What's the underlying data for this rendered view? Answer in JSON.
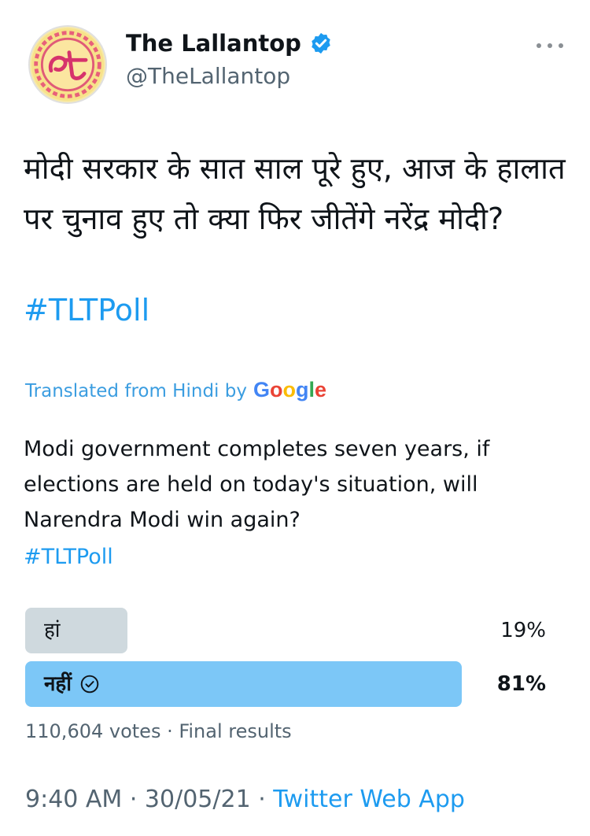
{
  "header": {
    "display_name": "The Lallantop",
    "handle": "@TheLallantop",
    "avatar_icon": "lallantop-logo",
    "verified_icon": "verified-badge-icon",
    "more_icon": "more-options-icon"
  },
  "tweet": {
    "hindi_text": "मोदी सरकार के सात साल पूरे हुए, आज के हालात पर चुनाव हुए तो क्या फिर जीतेंगे नरेंद्र मोदी?",
    "hashtag": "#TLTPoll"
  },
  "translation": {
    "label": "Translated from Hindi by",
    "google": [
      "G",
      "o",
      "o",
      "g",
      "l",
      "e"
    ],
    "english_text": "Modi government completes seven years, if elections are held on today's situation, will Narendra Modi win again?",
    "hashtag": "#TLTPoll"
  },
  "poll": {
    "options": [
      {
        "label": "हां",
        "percent": "19%",
        "fraction": 0.19,
        "winner": false
      },
      {
        "label": "नहीं",
        "percent": "81%",
        "fraction": 0.81,
        "winner": true
      }
    ],
    "votes_text": "110,604 votes · Final results"
  },
  "meta": {
    "time": "9:40 AM",
    "separator": " · ",
    "date": "30/05/21",
    "source": "Twitter Web App"
  },
  "colors": {
    "accent": "#1d9bf0",
    "loser_bar": "#cfd9de",
    "winner_bar": "#7cc7f7"
  }
}
